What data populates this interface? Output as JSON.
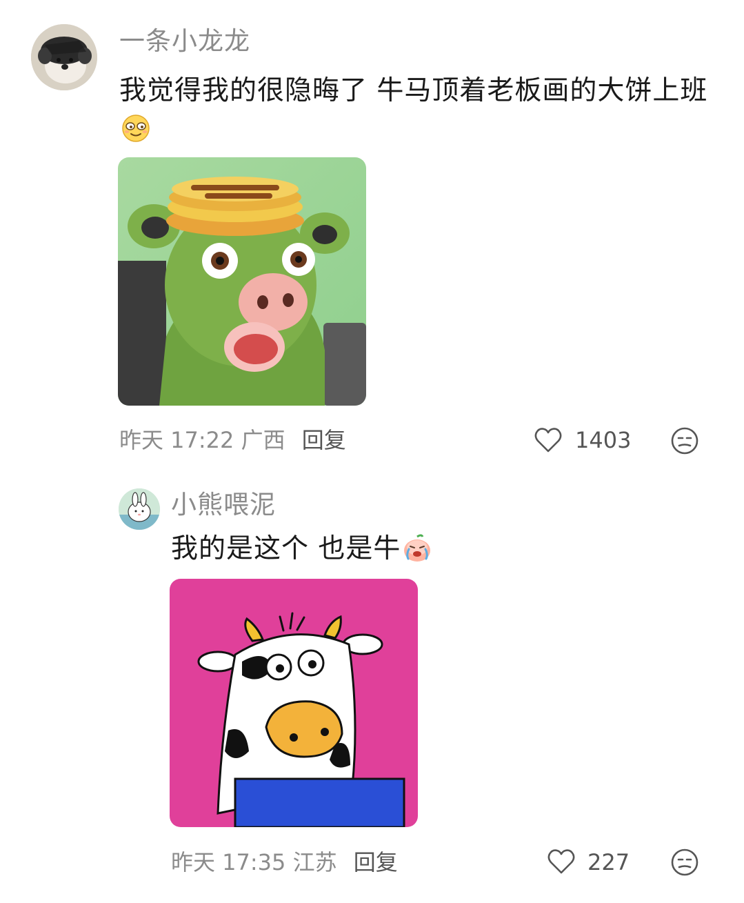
{
  "comments": [
    {
      "username": "一条小龙龙",
      "text": "我觉得我的很隐晦了 牛马顶着老板画的大饼上班",
      "emoji": "squinting-face-emoji",
      "image": "felt-cow-with-pancake-hat-image",
      "time": "昨天 17:22",
      "location": "广西",
      "reply_label": "回复",
      "likes": "1403"
    },
    {
      "username": "小熊喂泥",
      "text": "我的是这个 也是牛",
      "emoji": "crying-peach-emoji",
      "image": "cartoon-cow-at-laptop-image",
      "time": "昨天 17:35",
      "location": "江苏",
      "reply_label": "回复",
      "likes": "227"
    }
  ],
  "colors": {
    "secondary_text": "#8b8b8b",
    "primary_text": "#1a1a1a",
    "icon": "#555555"
  }
}
